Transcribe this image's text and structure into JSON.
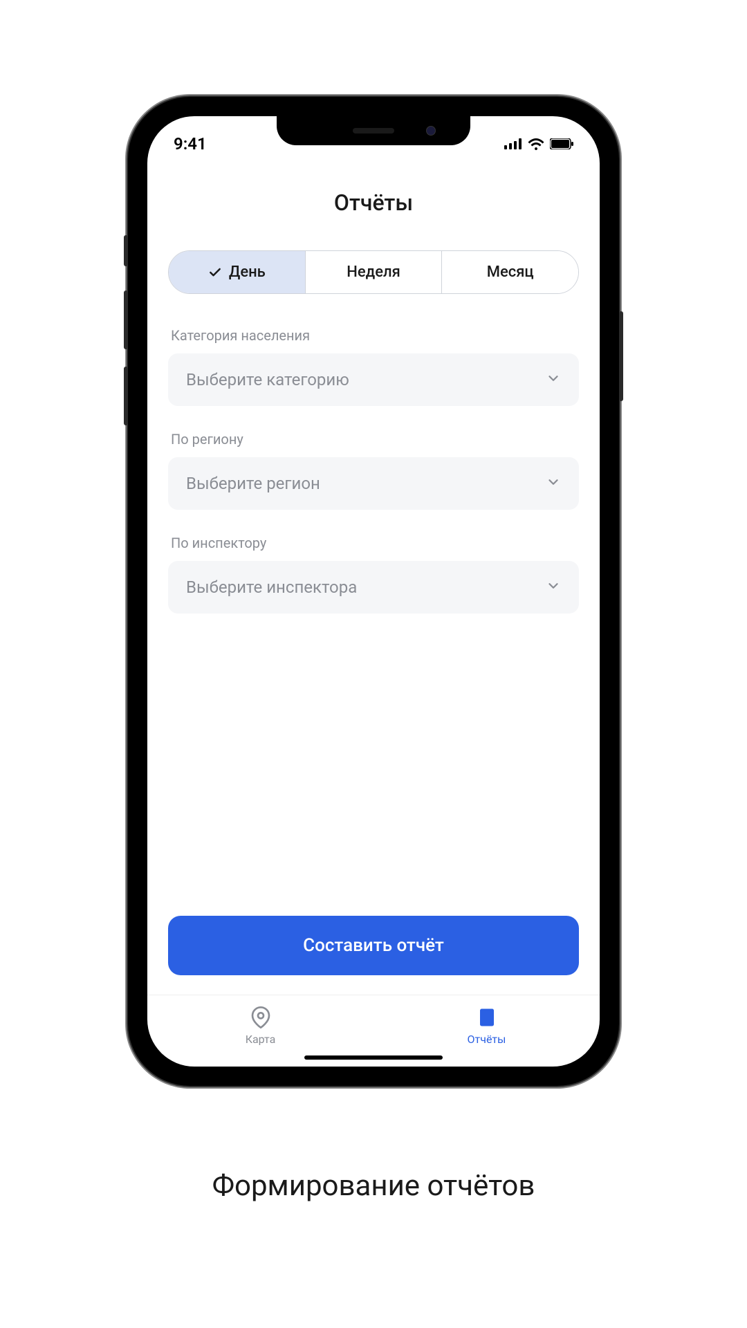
{
  "status_bar": {
    "time": "9:41"
  },
  "page_title": "Отчёты",
  "segmented": {
    "day": "День",
    "week": "Неделя",
    "month": "Месяц"
  },
  "fields": {
    "category": {
      "label": "Категория населения",
      "placeholder": "Выберите категорию"
    },
    "region": {
      "label": "По региону",
      "placeholder": "Выберите регион"
    },
    "inspector": {
      "label": "По инспектору",
      "placeholder": "Выберите инспектора"
    }
  },
  "primary_button": "Составить отчёт",
  "bottom_nav": {
    "map": "Карта",
    "reports": "Отчёты"
  },
  "caption": "Формирование отчётов"
}
